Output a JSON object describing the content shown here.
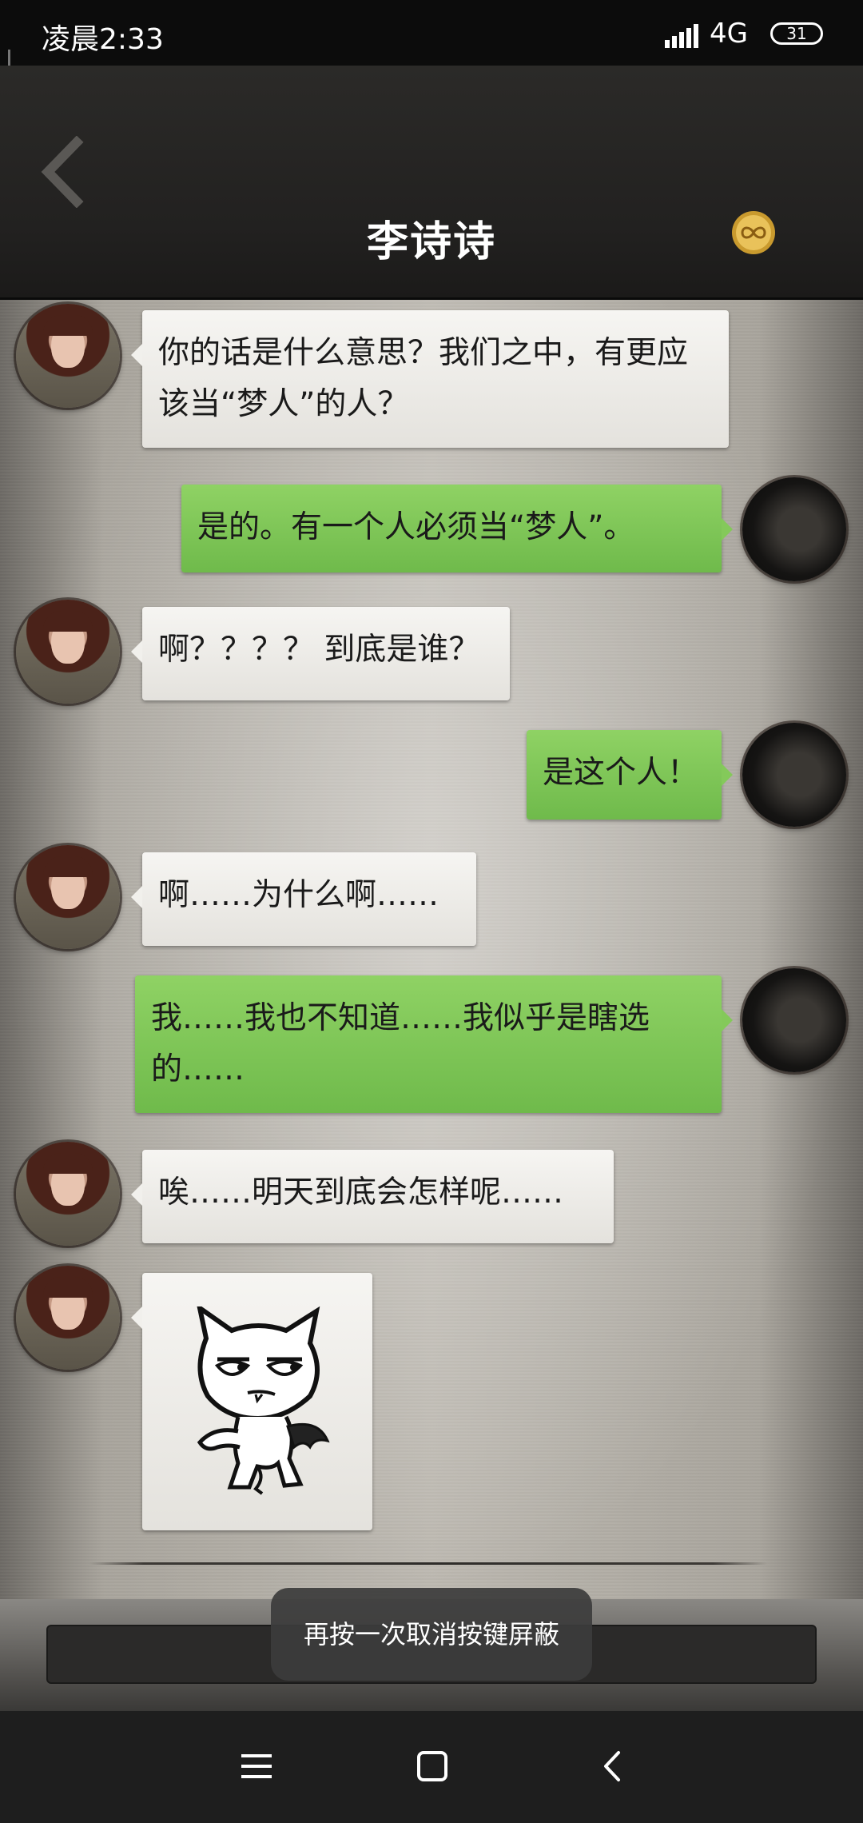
{
  "status_bar": {
    "time": "凌晨2:33",
    "network": "4G",
    "battery": "31"
  },
  "header": {
    "title": "李诗诗",
    "back_icon": "chevron-left-icon",
    "right_icon": "gold-infinity-badge-icon"
  },
  "messages": [
    {
      "side": "incoming",
      "text": "你的话是什么意思？我们之中，有更应该当“梦人”的人？"
    },
    {
      "side": "outgoing",
      "text": "是的。有一个人必须当“梦人”。"
    },
    {
      "side": "incoming",
      "text": "啊？？？？ 到底是谁？"
    },
    {
      "side": "outgoing",
      "text": "是这个人！"
    },
    {
      "side": "incoming",
      "text": "啊……为什么啊……"
    },
    {
      "side": "outgoing",
      "text": "我……我也不知道……我似乎是瞎选的……"
    },
    {
      "side": "incoming",
      "text": "唉……明天到底会怎样呢……"
    },
    {
      "side": "incoming",
      "type": "sticker",
      "sticker": "smug-cat-devil-sticker"
    }
  ],
  "toast": "再按一次取消按键屏蔽",
  "nav": {
    "menu_icon": "menu-icon",
    "home_icon": "home-square-icon",
    "back_icon": "back-chevron-icon"
  },
  "colors": {
    "outgoing_bubble": "#7cc452",
    "incoming_bubble": "#efeeea",
    "header_bg": "#232221"
  }
}
